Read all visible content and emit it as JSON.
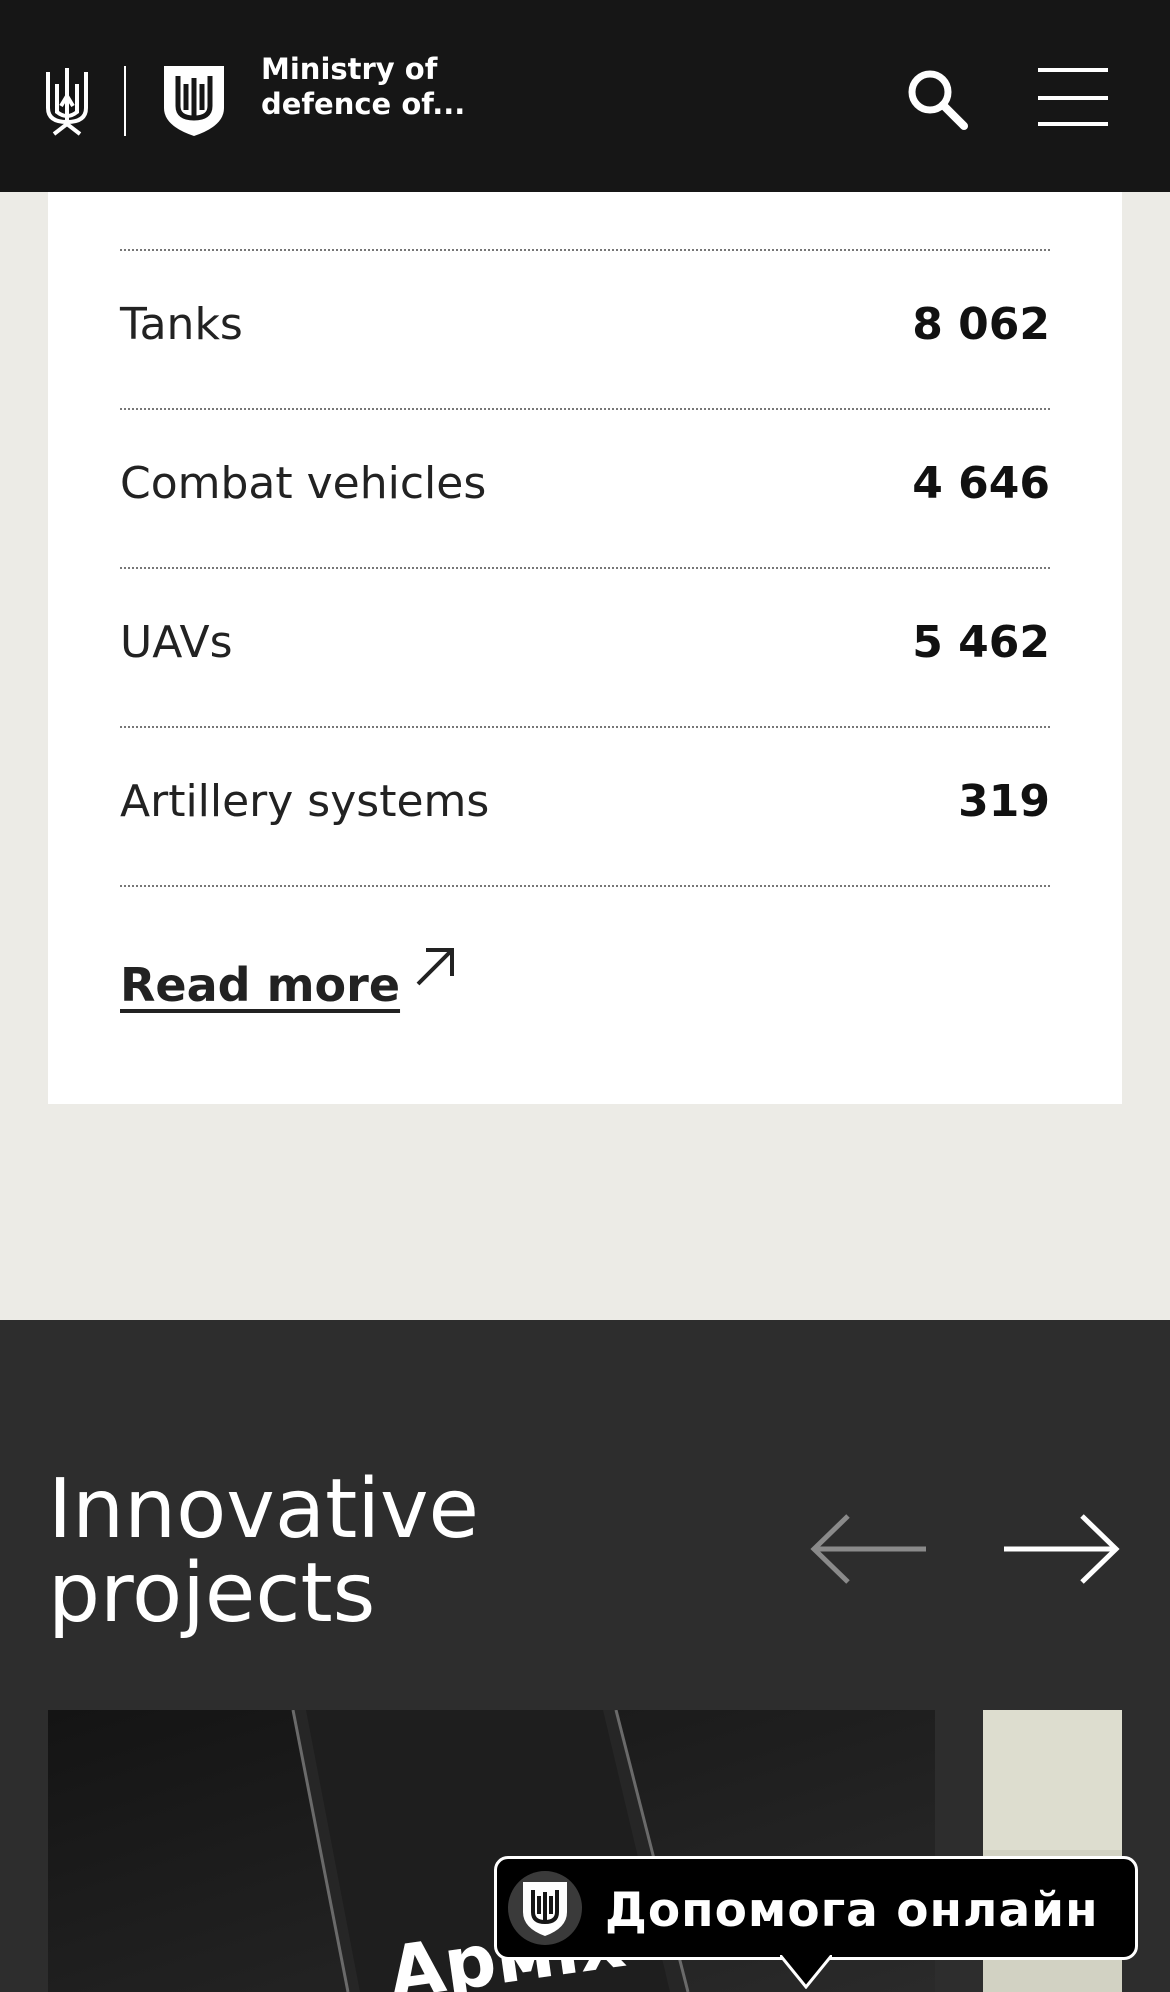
{
  "header": {
    "brand_line1": "Ministry of",
    "brand_line2": "defence of...",
    "icons": {
      "trident": "trident-emblem-icon",
      "shield": "mod-shield-logo",
      "search": "search-icon",
      "menu": "hamburger-menu-icon"
    }
  },
  "losses": {
    "items": [
      {
        "label": "Tanks",
        "value": "8 062"
      },
      {
        "label": "Combat vehicles",
        "value": "4 646"
      },
      {
        "label": "UAVs",
        "value": "5 462"
      },
      {
        "label": "Artillery systems",
        "value": "319"
      }
    ],
    "read_more_label": "Read more",
    "read_more_icon": "arrow-up-right-icon"
  },
  "projects": {
    "title_line1": "Innovative",
    "title_line2": "projects",
    "prev_icon": "arrow-left-icon",
    "next_icon": "arrow-right-icon",
    "card_text": "Арміх"
  },
  "help": {
    "label": "Допомога онлайн"
  },
  "colors": {
    "header_bg": "#161616",
    "page_bg": "#ecebe6",
    "dark_section_bg": "#2d2d2d",
    "card_bg": "#ffffff"
  }
}
